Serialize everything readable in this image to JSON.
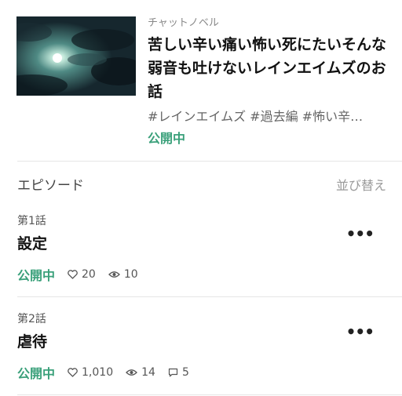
{
  "work": {
    "genre": "チャットノベル",
    "title": "苦しい辛い痛い怖い死にたいそんな弱音も吐けないレインエイムズのお話",
    "tags": "#レインエイムズ #過去編 #怖い辛…",
    "status": "公開中",
    "cover_image": "night-sky-moon-clouds"
  },
  "episodes_header": {
    "label": "エピソード",
    "sort_label": "並び替え"
  },
  "episodes": [
    {
      "number_label": "第1話",
      "title": "設定",
      "status": "公開中",
      "likes": "20",
      "views": "10",
      "comments": null
    },
    {
      "number_label": "第2話",
      "title": "虐待",
      "status": "公開中",
      "likes": "1,010",
      "views": "14",
      "comments": "5"
    }
  ],
  "colors": {
    "accent_green": "#3aa07a",
    "muted_text": "#888888",
    "divider": "#e6e6e6"
  },
  "icons": {
    "like": "heart-outline-icon",
    "views": "eye-icon",
    "comments": "speech-bubble-icon",
    "more": "ellipsis-icon"
  }
}
